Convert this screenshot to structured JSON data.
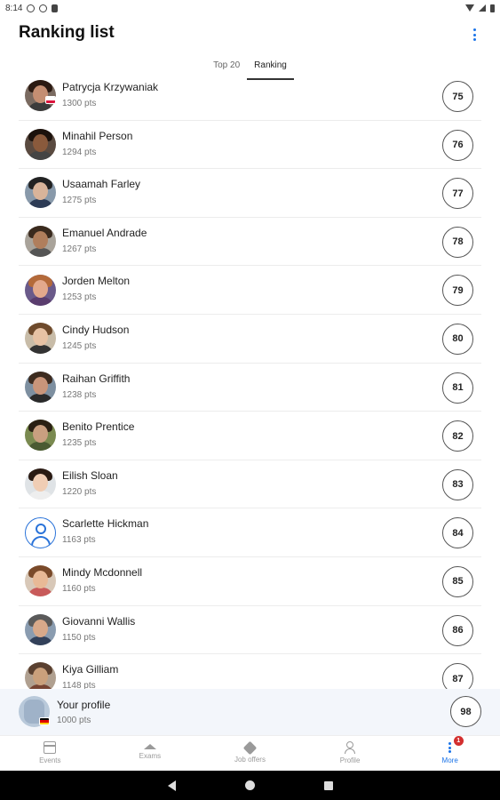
{
  "status_bar": {
    "time": "8:14"
  },
  "header": {
    "title": "Ranking list"
  },
  "tabs": [
    {
      "label": "Top 20",
      "active": false
    },
    {
      "label": "Ranking",
      "active": true
    }
  ],
  "ranking": [
    {
      "name": "Patrycja Krzywaniak",
      "points": "1300 pts",
      "rank": "75",
      "skin": "#c48e72",
      "hair": "#2b1a12",
      "body": "#3b3b3b",
      "bg": "#7a6a60",
      "flag": "pl"
    },
    {
      "name": "Minahil Person",
      "points": "1294 pts",
      "rank": "76",
      "skin": "#8a5a3c",
      "hair": "#1c120c",
      "body": "#444",
      "bg": "#5a4a40"
    },
    {
      "name": "Usaamah Farley",
      "points": "1275 pts",
      "rank": "77",
      "skin": "#d9b49a",
      "hair": "#222",
      "body": "#2d3b55",
      "bg": "#8899aa"
    },
    {
      "name": "Emanuel Andrade",
      "points": "1267 pts",
      "rank": "78",
      "skin": "#b07e5c",
      "hair": "#3a2a1e",
      "body": "#555",
      "bg": "#a9a39a"
    },
    {
      "name": "Jorden Melton",
      "points": "1253 pts",
      "rank": "79",
      "skin": "#e3a98c",
      "hair": "#b46a3a",
      "body": "#5a3d6e",
      "bg": "#6a5a8a"
    },
    {
      "name": "Cindy Hudson",
      "points": "1245 pts",
      "rank": "80",
      "skin": "#e7c2a4",
      "hair": "#6e4a2c",
      "body": "#333",
      "bg": "#c8bca8"
    },
    {
      "name": "Raihan Griffith",
      "points": "1238 pts",
      "rank": "81",
      "skin": "#c9957a",
      "hair": "#3d2b1f",
      "body": "#2a2a2a",
      "bg": "#7d8fa0"
    },
    {
      "name": "Benito Prentice",
      "points": "1235 pts",
      "rank": "82",
      "skin": "#c99f80",
      "hair": "#2a2014",
      "body": "#4a5a32",
      "bg": "#7a8a50"
    },
    {
      "name": "Eilish Sloan",
      "points": "1220 pts",
      "rank": "83",
      "skin": "#f0cdb4",
      "hair": "#2a1a12",
      "body": "#eee",
      "bg": "#dfe3e6"
    },
    {
      "name": "Scarlette Hickman",
      "points": "1163 pts",
      "rank": "84",
      "generic": true
    },
    {
      "name": "Mindy Mcdonnell",
      "points": "1160 pts",
      "rank": "85",
      "skin": "#e8b996",
      "hair": "#7a4a2a",
      "body": "#c85a5a",
      "bg": "#d8c8b8"
    },
    {
      "name": "Giovanni Wallis",
      "points": "1150 pts",
      "rank": "86",
      "skin": "#d8a98a",
      "hair": "#5a5a5a",
      "body": "#33415a",
      "bg": "#8a9cb0"
    },
    {
      "name": "Kiya Gilliam",
      "points": "1148 pts",
      "rank": "87",
      "skin": "#caa07c",
      "hair": "#5a4030",
      "body": "#774433",
      "bg": "#b0a090"
    }
  ],
  "your_profile": {
    "label": "Your profile",
    "points": "1000 pts",
    "rank": "98"
  },
  "bottom_nav": [
    {
      "label": "Events",
      "icon": "calendar-icon",
      "active": false
    },
    {
      "label": "Exams",
      "icon": "graduation-cap-icon",
      "active": false
    },
    {
      "label": "Job offers",
      "icon": "tag-icon",
      "active": false
    },
    {
      "label": "Profile",
      "icon": "person-icon",
      "active": false
    },
    {
      "label": "More",
      "icon": "more-vertical-icon",
      "active": true,
      "badge": "1"
    }
  ]
}
